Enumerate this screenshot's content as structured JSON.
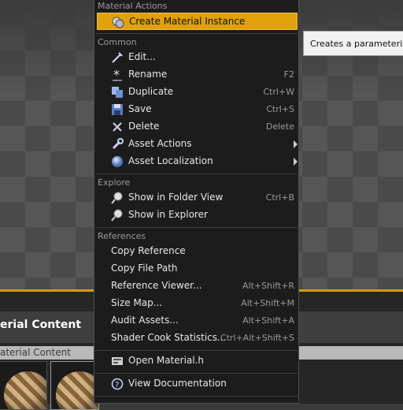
{
  "colors": {
    "accent": "#e0a10c",
    "menu_bg": "#1c1c1c",
    "tooltip_bg": "#f1f1f1"
  },
  "content_browser": {
    "title": "erial Content",
    "subtitle": "aterial Content"
  },
  "tooltip": {
    "text": "Creates a parameterize"
  },
  "menu": {
    "material_actions": {
      "header": "Material Actions",
      "create_instance": {
        "label": "Create Material Instance",
        "icon": "material-instance-icon"
      }
    },
    "common": {
      "header": "Common",
      "items": [
        {
          "label": "Edit...",
          "shortcut": "",
          "icon": "edit-wand-icon"
        },
        {
          "label": "Rename",
          "shortcut": "F2",
          "icon": "rename-star-icon"
        },
        {
          "label": "Duplicate",
          "shortcut": "Ctrl+W",
          "icon": "duplicate-icon"
        },
        {
          "label": "Save",
          "shortcut": "Ctrl+S",
          "icon": "save-disk-icon"
        },
        {
          "label": "Delete",
          "shortcut": "Delete",
          "icon": "delete-x-icon"
        },
        {
          "label": "Asset Actions",
          "shortcut": "",
          "icon": "wrench-icon",
          "submenu": true
        },
        {
          "label": "Asset Localization",
          "shortcut": "",
          "icon": "globe-icon",
          "submenu": true
        }
      ]
    },
    "explore": {
      "header": "Explore",
      "items": [
        {
          "label": "Show in Folder View",
          "shortcut": "Ctrl+B",
          "icon": "magnifier-icon"
        },
        {
          "label": "Show in Explorer",
          "shortcut": "",
          "icon": "magnifier-icon"
        }
      ]
    },
    "references": {
      "header": "References",
      "items": [
        {
          "label": "Copy Reference",
          "shortcut": ""
        },
        {
          "label": "Copy File Path",
          "shortcut": ""
        },
        {
          "label": "Reference Viewer...",
          "shortcut": "Alt+Shift+R"
        },
        {
          "label": "Size Map...",
          "shortcut": "Alt+Shift+M"
        },
        {
          "label": "Audit Assets...",
          "shortcut": "Alt+Shift+A"
        },
        {
          "label": "Shader Cook Statistics...",
          "shortcut": "Ctrl+Alt+Shift+S"
        }
      ]
    },
    "source": {
      "open_label": "Open Material.h",
      "icon": "source-file-icon"
    },
    "docs": {
      "label": "View Documentation",
      "icon": "help-circle-icon"
    }
  }
}
